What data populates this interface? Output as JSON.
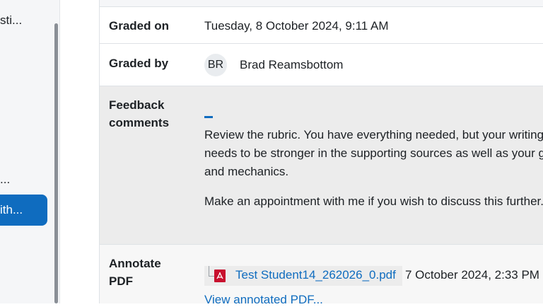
{
  "sidebar": {
    "items": [
      {
        "label": "sti..."
      },
      {
        "label": "..."
      }
    ],
    "active_item": {
      "label": "ith..."
    }
  },
  "feedback_table": {
    "graded_on": {
      "label": "Graded on",
      "value": "Tuesday, 8 October 2024, 9:11 AM"
    },
    "graded_by": {
      "label": "Graded by",
      "avatar_initials": "BR",
      "value": "Brad Reamsbottom"
    },
    "feedback_comments": {
      "label": "Feedback comments",
      "paragraph_1": [
        "Review the rubric. You have everything needed, but your writing j",
        "needs to be stronger in the supporting sources as well as your gr",
        "and mechanics."
      ],
      "paragraph_2": "Make an appointment with me if you wish to discuss this further."
    },
    "annotate_pdf": {
      "label": "Annotate PDF",
      "file_name": "Test Student14_262026_0.pdf",
      "file_date": "7 October 2024, 2:33 PM",
      "view_link": "View annotated PDF..."
    }
  }
}
